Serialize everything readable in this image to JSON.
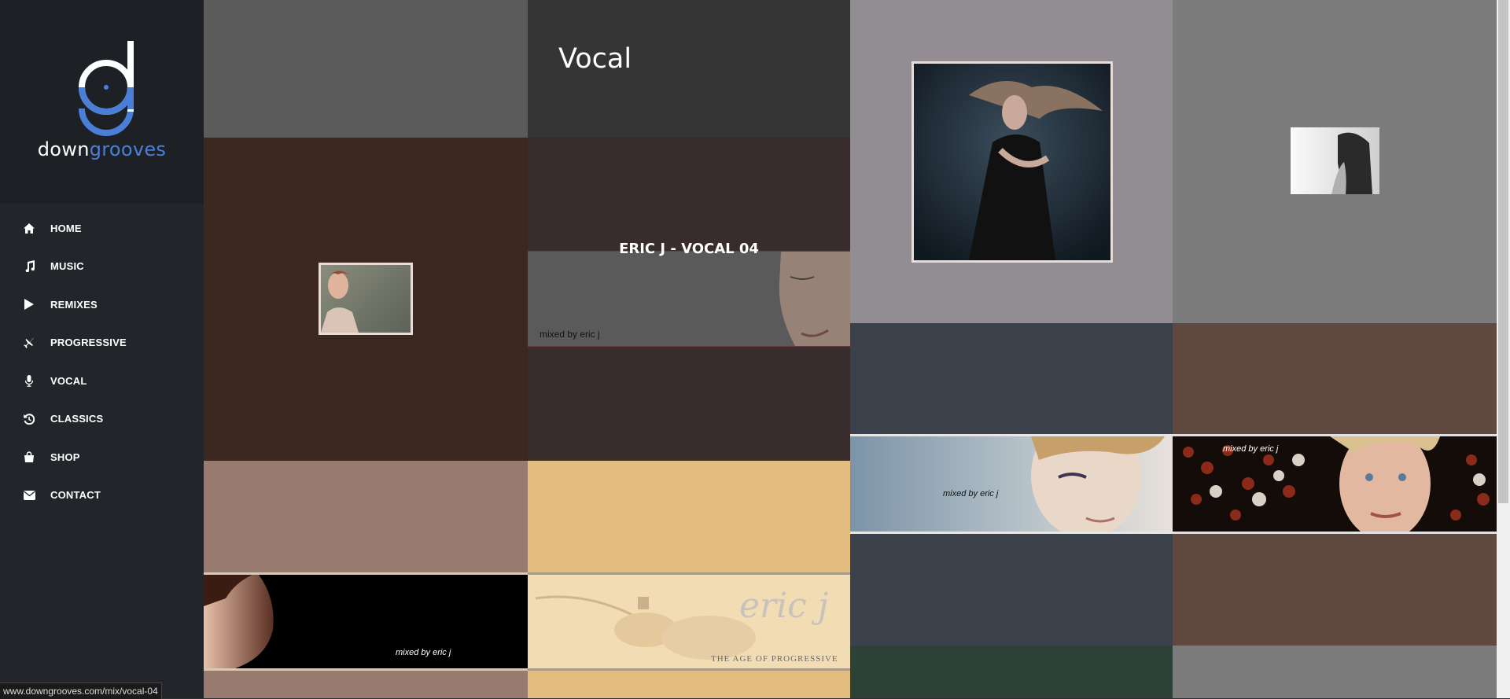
{
  "brand": {
    "word_plain": "down",
    "word_accent": "grooves",
    "accent_color": "#4a7fd8"
  },
  "nav": [
    {
      "label": "HOME",
      "icon": "home-icon"
    },
    {
      "label": "MUSIC",
      "icon": "music-icon"
    },
    {
      "label": "REMIXES",
      "icon": "play-icon"
    },
    {
      "label": "PROGRESSIVE",
      "icon": "plane-icon"
    },
    {
      "label": "VOCAL",
      "icon": "microphone-icon"
    },
    {
      "label": "CLASSICS",
      "icon": "history-icon"
    },
    {
      "label": "SHOP",
      "icon": "shopping-bag-icon"
    },
    {
      "label": "CONTACT",
      "icon": "envelope-icon"
    }
  ],
  "page": {
    "title": "Vocal"
  },
  "hovered_mix": {
    "title": "ERIC J - VOCAL 04",
    "caption": "mixed by eric j"
  },
  "banners": {
    "vocal_left": {
      "caption": "mixed by eric j"
    },
    "vocal_right": {
      "caption": "mixed by eric j"
    },
    "vocal_bottom": {
      "caption": "mixed by eric j"
    },
    "progressive": {
      "logo": "eric j",
      "subtitle": "THE AGE OF PROGRESSIVE"
    }
  },
  "status": {
    "url": "www.downgrooves.com/mix/vocal-04"
  }
}
